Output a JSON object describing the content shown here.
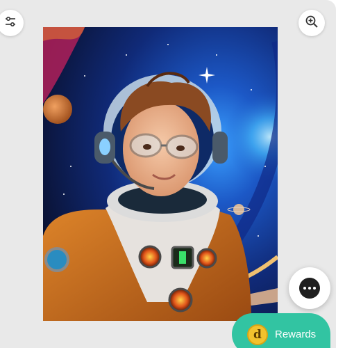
{
  "toolbar": {
    "filter_icon": "sliders-icon",
    "zoom_icon": "zoom-in-icon"
  },
  "artwork": {
    "subject": "illustration"
  },
  "chat": {
    "icon": "chat-bubble-icon"
  },
  "rewards": {
    "label": "Rewards",
    "coin_letter": "d",
    "color": "#32c4a2"
  },
  "colors": {
    "viewer_background": "#e9e9e9",
    "rewards_accent": "#32c4a2",
    "coin": "#f2c22e"
  }
}
